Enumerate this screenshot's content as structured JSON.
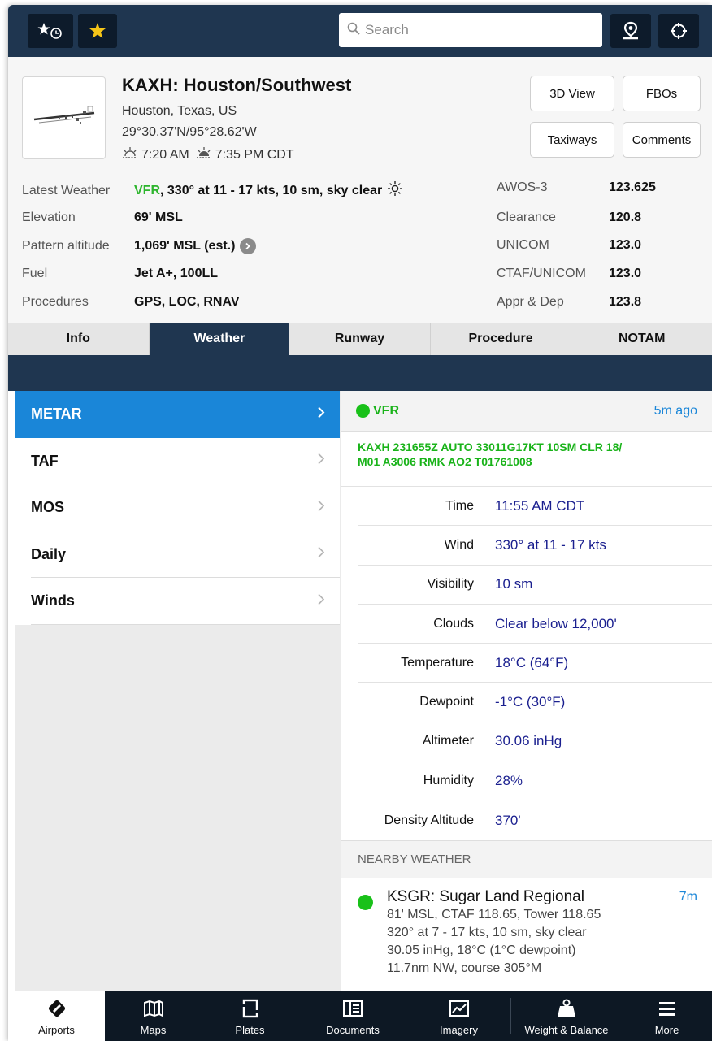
{
  "topbar": {
    "recents_icon": "star-clock-icon",
    "favorites_icon": "star-icon",
    "search_placeholder": "Search",
    "map_pin_icon": "map-pin-icon",
    "locate_icon": "crosshair-icon"
  },
  "airport": {
    "title": "KAXH: Houston/Southwest",
    "location": "Houston, Texas, US",
    "coordinates": "29°30.37'N/95°28.62'W",
    "sunrise": "7:20 AM",
    "sunset": "7:35 PM CDT",
    "buttons": {
      "view3d": "3D View",
      "fbos": "FBOs",
      "taxiways": "Taxiways",
      "comments": "Comments"
    },
    "info": [
      {
        "label": "Latest Weather",
        "value_cat": "VFR",
        "value_rest": ", 330° at 11 - 17 kts, 10 sm, sky clear"
      },
      {
        "label": "Elevation",
        "value": "69' MSL"
      },
      {
        "label": "Pattern altitude",
        "value": "1,069' MSL (est.)"
      },
      {
        "label": "Fuel",
        "value": "Jet A+, 100LL"
      },
      {
        "label": "Procedures",
        "value": "GPS, LOC, RNAV"
      }
    ],
    "frequencies": [
      {
        "label": "AWOS-3",
        "value": "123.625"
      },
      {
        "label": "Clearance",
        "value": "120.8"
      },
      {
        "label": "UNICOM",
        "value": "123.0"
      },
      {
        "label": "CTAF/UNICOM",
        "value": "123.0"
      },
      {
        "label": "Appr & Dep",
        "value": "123.8"
      }
    ]
  },
  "tabs": [
    "Info",
    "Weather",
    "Runway",
    "Procedure",
    "NOTAM"
  ],
  "active_tab": "Weather",
  "weather_menu": [
    "METAR",
    "TAF",
    "MOS",
    "Daily",
    "Winds"
  ],
  "metar": {
    "category": "VFR",
    "age": "5m ago",
    "raw_line1": "KAXH 231655Z AUTO 33011G17KT 10SM CLR 18/",
    "raw_line2": "M01 A3006 RMK AO2 T01761008",
    "rows": [
      {
        "k": "Time",
        "v": "11:55 AM CDT"
      },
      {
        "k": "Wind",
        "v": "330° at 11 - 17 kts"
      },
      {
        "k": "Visibility",
        "v": "10 sm"
      },
      {
        "k": "Clouds",
        "v": "Clear below 12,000'"
      },
      {
        "k": "Temperature",
        "v": "18°C (64°F)"
      },
      {
        "k": "Dewpoint",
        "v": "-1°C (30°F)"
      },
      {
        "k": "Altimeter",
        "v": "30.06 inHg"
      },
      {
        "k": "Humidity",
        "v": "28%"
      },
      {
        "k": "Density Altitude",
        "v": "370'"
      }
    ]
  },
  "nearby": {
    "header": "NEARBY WEATHER",
    "station": {
      "name": "KSGR: Sugar Land Regional",
      "age": "7m",
      "line1": "81' MSL, CTAF 118.65, Tower 118.65",
      "line2": "320° at 7 - 17 kts, 10 sm, sky clear",
      "line3": "30.05 inHg, 18°C (1°C dewpoint)",
      "line4": "11.7nm NW, course 305°M"
    }
  },
  "bottom_nav": [
    {
      "label": "Airports",
      "icon": "airports-icon"
    },
    {
      "label": "Maps",
      "icon": "maps-icon"
    },
    {
      "label": "Plates",
      "icon": "plates-icon"
    },
    {
      "label": "Documents",
      "icon": "documents-icon"
    },
    {
      "label": "Imagery",
      "icon": "imagery-icon"
    },
    {
      "label": "Weight & Balance",
      "icon": "weight-icon"
    },
    {
      "label": "More",
      "icon": "menu-icon"
    }
  ],
  "colors": {
    "navy": "#1f3650",
    "accent_blue": "#1a86d8",
    "vfr_green": "#19c119",
    "value_blue": "#1a1f8f"
  }
}
